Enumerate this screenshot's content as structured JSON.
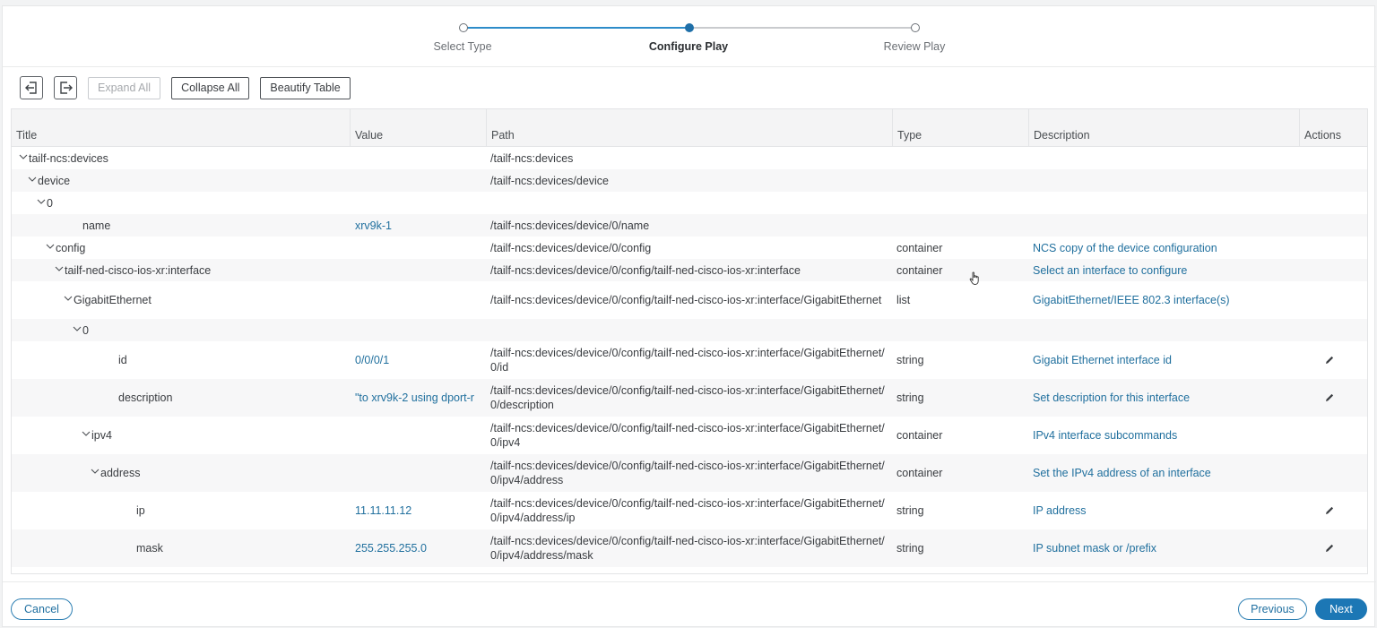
{
  "stepper": {
    "steps": [
      {
        "label": "Select Type",
        "state": "done"
      },
      {
        "label": "Configure Play",
        "state": "active"
      },
      {
        "label": "Review Play",
        "state": "pending"
      }
    ]
  },
  "toolbar": {
    "import_icon": "import-icon",
    "export_icon": "export-icon",
    "expand_all": "Expand All",
    "collapse_all": "Collapse All",
    "beautify_table": "Beautify Table"
  },
  "table": {
    "columns": [
      "Title",
      "Value",
      "Path",
      "Type",
      "Description",
      "Actions"
    ],
    "rows": [
      {
        "title": "tailf-ncs:devices",
        "value": "",
        "path": "/tailf-ncs:devices",
        "type": "",
        "description": "",
        "depth": 0,
        "expandable": true,
        "editable": false
      },
      {
        "title": "device",
        "value": "",
        "path": "/tailf-ncs:devices/device",
        "type": "",
        "description": "",
        "depth": 1,
        "expandable": true,
        "editable": false
      },
      {
        "title": "0",
        "value": "",
        "path": "",
        "type": "",
        "description": "",
        "depth": 2,
        "expandable": true,
        "editable": false
      },
      {
        "title": "name",
        "value": "xrv9k-1",
        "path": "/tailf-ncs:devices/device/0/name",
        "type": "",
        "description": "",
        "depth": 3,
        "expandable": false,
        "editable": false
      },
      {
        "title": "config",
        "value": "",
        "path": "/tailf-ncs:devices/device/0/config",
        "type": "container",
        "description": "NCS copy of the device configuration",
        "depth": 3,
        "expandable": true,
        "editable": false
      },
      {
        "title": "tailf-ned-cisco-ios-xr:interface",
        "value": "",
        "path": "/tailf-ncs:devices/device/0/config/tailf-ned-cisco-ios-xr:interface",
        "type": "container",
        "description": "Select an interface to configure",
        "depth": 4,
        "expandable": true,
        "editable": false
      },
      {
        "title": "GigabitEthernet",
        "value": "",
        "path": "/tailf-ncs:devices/device/0/config/tailf-ned-cisco-ios-xr:interface/GigabitEthernet",
        "type": "list",
        "description": "GigabitEthernet/IEEE 802.3 interface(s)",
        "depth": 5,
        "expandable": true,
        "editable": false
      },
      {
        "title": "0",
        "value": "",
        "path": "",
        "type": "",
        "description": "",
        "depth": 6,
        "expandable": true,
        "editable": false
      },
      {
        "title": "id",
        "value": "0/0/0/1",
        "path": "/tailf-ncs:devices/device/0/config/tailf-ned-cisco-ios-xr:interface/GigabitEthernet/0/id",
        "type": "string",
        "description": "Gigabit Ethernet interface id",
        "depth": 7,
        "expandable": false,
        "editable": true
      },
      {
        "title": "description",
        "value": "\"to xrv9k-2 using dport-r",
        "path": "/tailf-ncs:devices/device/0/config/tailf-ned-cisco-ios-xr:interface/GigabitEthernet/0/description",
        "type": "string",
        "description": "Set description for this interface",
        "depth": 7,
        "expandable": false,
        "editable": true
      },
      {
        "title": "ipv4",
        "value": "",
        "path": "/tailf-ncs:devices/device/0/config/tailf-ned-cisco-ios-xr:interface/GigabitEthernet/0/ipv4",
        "type": "container",
        "description": "IPv4 interface subcommands",
        "depth": 7,
        "expandable": true,
        "editable": false
      },
      {
        "title": "address",
        "value": "",
        "path": "/tailf-ncs:devices/device/0/config/tailf-ned-cisco-ios-xr:interface/GigabitEthernet/0/ipv4/address",
        "type": "container",
        "description": "Set the IPv4 address of an interface",
        "depth": 8,
        "expandable": true,
        "editable": false
      },
      {
        "title": "ip",
        "value": "11.11.11.12",
        "path": "/tailf-ncs:devices/device/0/config/tailf-ned-cisco-ios-xr:interface/GigabitEthernet/0/ipv4/address/ip",
        "type": "string",
        "description": "IP address",
        "depth": 9,
        "expandable": false,
        "editable": true
      },
      {
        "title": "mask",
        "value": "255.255.255.0",
        "path": "/tailf-ncs:devices/device/0/config/tailf-ned-cisco-ios-xr:interface/GigabitEthernet/0/ipv4/address/mask",
        "type": "string",
        "description": "IP subnet mask or /prefix",
        "depth": 9,
        "expandable": false,
        "editable": true
      }
    ]
  },
  "footer": {
    "cancel": "Cancel",
    "previous": "Previous",
    "next": "Next"
  },
  "colors": {
    "accent": "#1c77b5",
    "link": "#21709e"
  }
}
